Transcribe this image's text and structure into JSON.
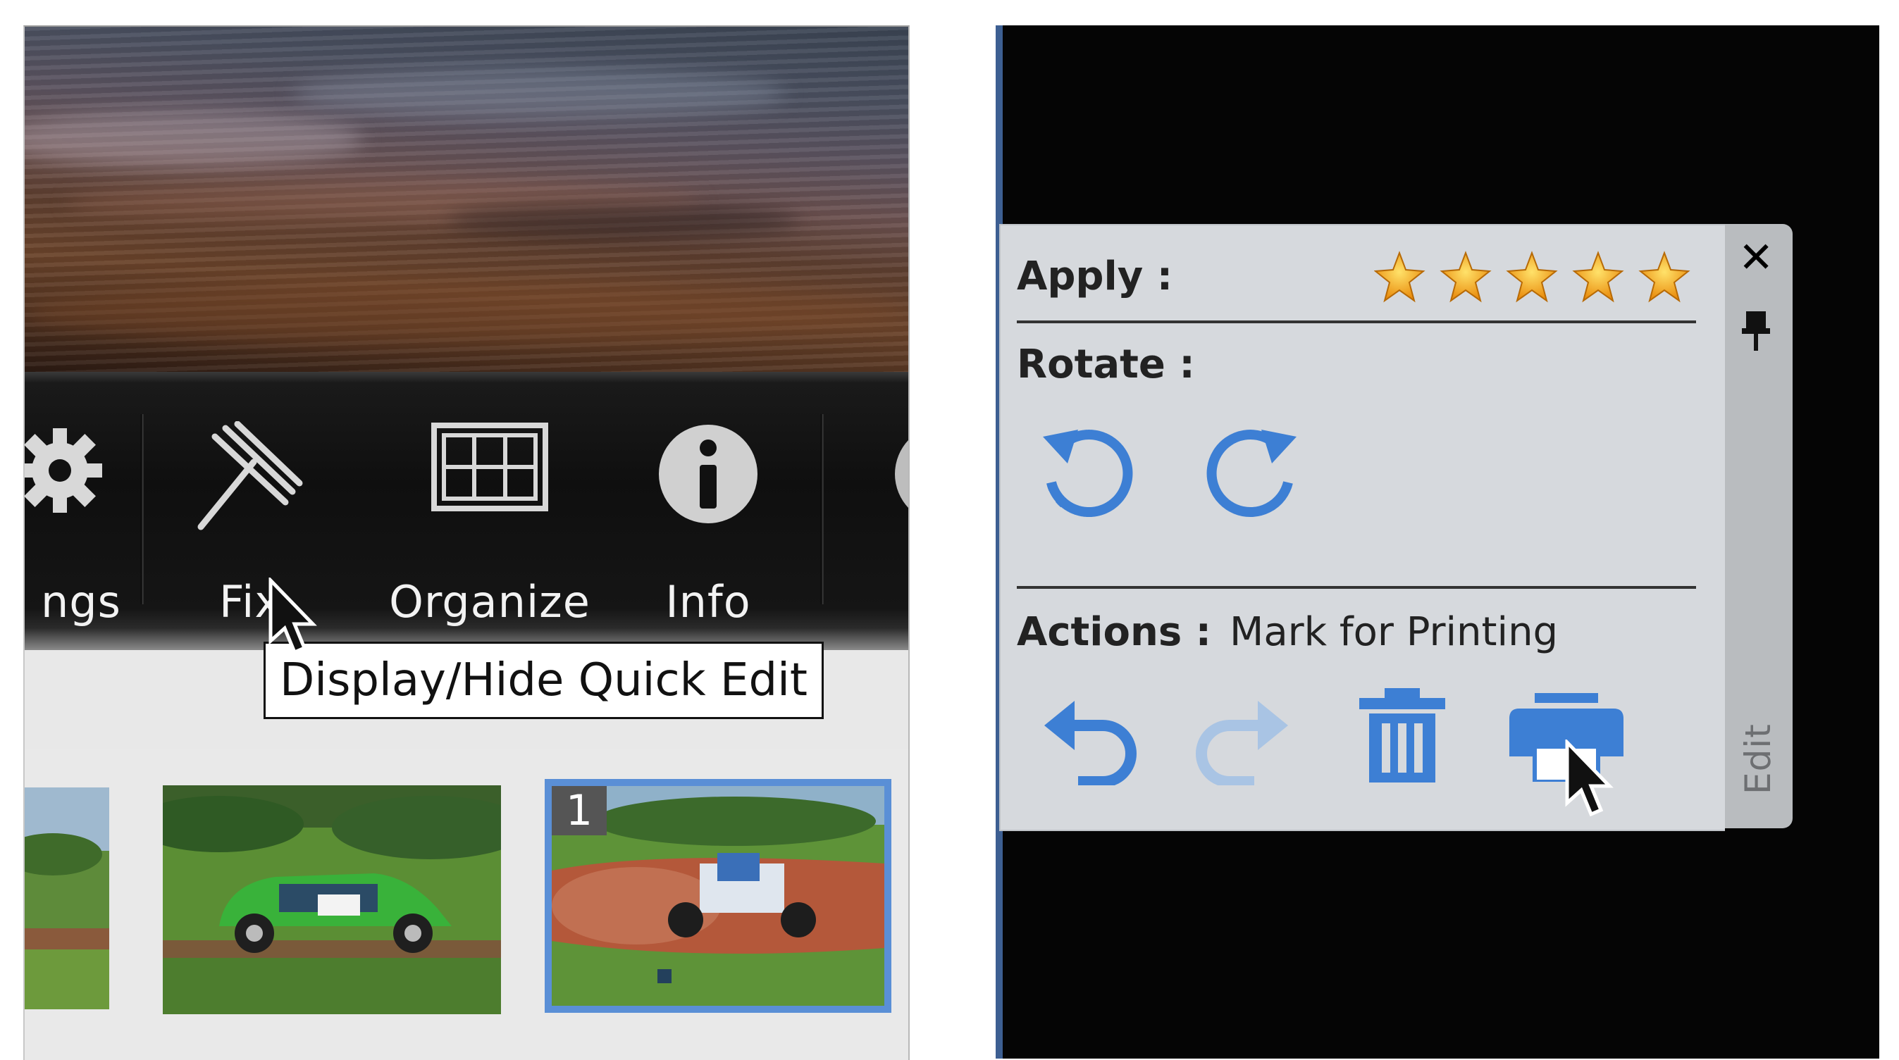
{
  "left_panel": {
    "toolbar": {
      "items": [
        {
          "label": "ngs",
          "icon": "gear-icon"
        },
        {
          "label": "Fix",
          "icon": "fix-wand-icon"
        },
        {
          "label": "Organize",
          "icon": "grid-icon"
        },
        {
          "label": "Info",
          "icon": "info-icon"
        }
      ]
    },
    "tooltip": "Display/Hide Quick Edit",
    "filmstrip": {
      "thumbnails": [
        {
          "badge": ""
        },
        {
          "badge": ""
        },
        {
          "badge": "1",
          "selected": true
        }
      ]
    }
  },
  "quick_edit": {
    "apply_label": "Apply :",
    "rating": 5,
    "rotate_label": "Rotate :",
    "actions_label": "Actions :",
    "actions_status": "Mark for Printing",
    "side_tab_label": "Edit",
    "close_icon": "close-icon",
    "pin_icon": "pin-icon",
    "buttons": [
      {
        "name": "rotate-left-icon"
      },
      {
        "name": "rotate-right-icon"
      },
      {
        "name": "undo-icon"
      },
      {
        "name": "redo-icon",
        "disabled": true
      },
      {
        "name": "trash-icon"
      },
      {
        "name": "print-icon"
      }
    ]
  },
  "colors": {
    "accent_blue": "#3d7fd4",
    "star_orange": "#f2a21a",
    "panel_bg": "#d6d9dd",
    "selection_border": "#5a8fd6"
  }
}
